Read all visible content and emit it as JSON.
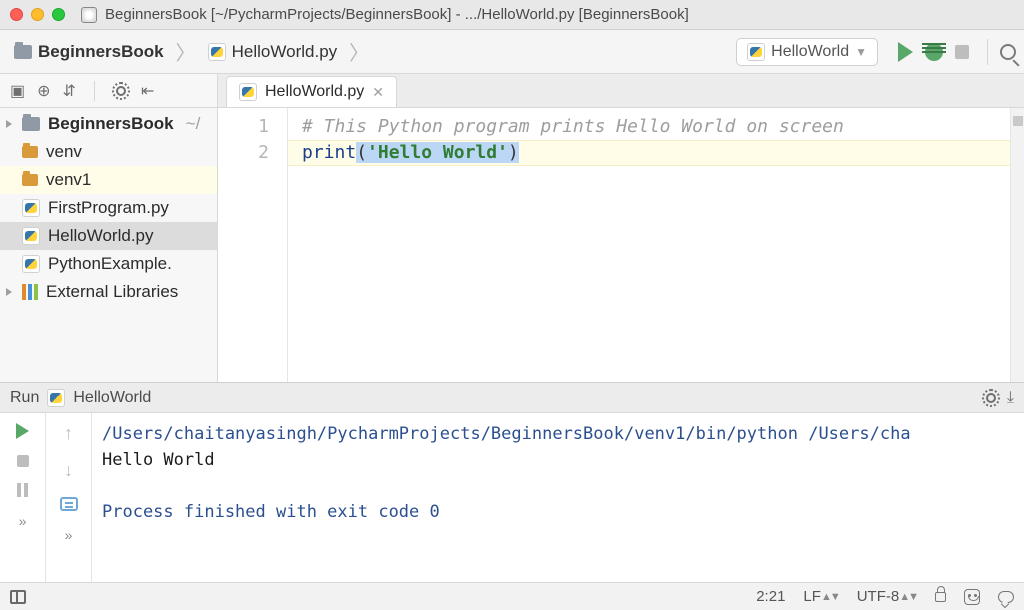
{
  "window": {
    "title": "BeginnersBook [~/PycharmProjects/BeginnersBook] - .../HelloWorld.py [BeginnersBook]"
  },
  "breadcrumb": {
    "project": "BeginnersBook",
    "file": "HelloWorld.py"
  },
  "run_config": {
    "selected": "HelloWorld"
  },
  "project_tree": {
    "root": {
      "name": "BeginnersBook",
      "path": "~/"
    },
    "children": [
      {
        "name": "venv",
        "type": "dir"
      },
      {
        "name": "venv1",
        "type": "dir",
        "highlighted": true
      },
      {
        "name": "FirstProgram.py",
        "type": "py"
      },
      {
        "name": "HelloWorld.py",
        "type": "py",
        "selected": true
      },
      {
        "name": "PythonExample.",
        "type": "py"
      }
    ],
    "external": "External Libraries"
  },
  "editor": {
    "tab_label": "HelloWorld.py",
    "lines": [
      "1",
      "2"
    ],
    "code": {
      "comment": "# This Python program prints Hello World on screen",
      "builtin": "print",
      "open_paren": "(",
      "string": "'Hello World'",
      "close_paren": ")"
    }
  },
  "run": {
    "title_prefix": "Run",
    "title_config": "HelloWorld",
    "cmd": "/Users/chaitanyasingh/PycharmProjects/BeginnersBook/venv1/bin/python /Users/cha",
    "stdout": "Hello World",
    "exit_msg": "Process finished with exit code 0",
    "more": "»"
  },
  "status": {
    "cursor": "2:21",
    "line_sep": "LF",
    "encoding": "UTF-8"
  }
}
